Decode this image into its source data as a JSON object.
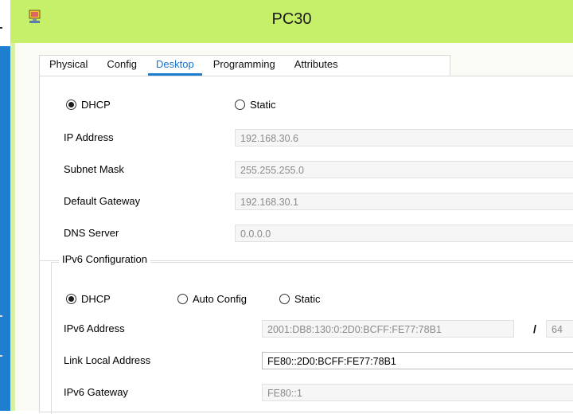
{
  "window": {
    "title": "PC30"
  },
  "tabs": [
    {
      "label": "Physical"
    },
    {
      "label": "Config"
    },
    {
      "label": "Desktop"
    },
    {
      "label": "Programming"
    },
    {
      "label": "Attributes"
    }
  ],
  "ipv4": {
    "dhcp_label": "DHCP",
    "static_label": "Static",
    "ip_label": "IP Address",
    "ip_value": "192.168.30.6",
    "mask_label": "Subnet Mask",
    "mask_value": "255.255.255.0",
    "gateway_label": "Default Gateway",
    "gateway_value": "192.168.30.1",
    "dns_label": "DNS Server",
    "dns_value": "0.0.0.0"
  },
  "ipv6": {
    "group_label": "IPv6 Configuration",
    "dhcp_label": "DHCP",
    "auto_label": "Auto Config",
    "static_label": "Static",
    "address_label": "IPv6 Address",
    "address_value": "2001:DB8:130:0:2D0:BCFF:FE77:78B1",
    "prefix_separator": "/",
    "prefix_value": "64",
    "link_local_label": "Link Local Address",
    "link_local_value": "FE80::2D0:BCFF:FE77:78B1",
    "gateway_label": "IPv6 Gateway",
    "gateway_value": "FE80::1"
  },
  "colors": {
    "title_bar": "#c7f06a",
    "active_tab": "#1a73c7",
    "desktop_strip": "#1e7fd0"
  }
}
